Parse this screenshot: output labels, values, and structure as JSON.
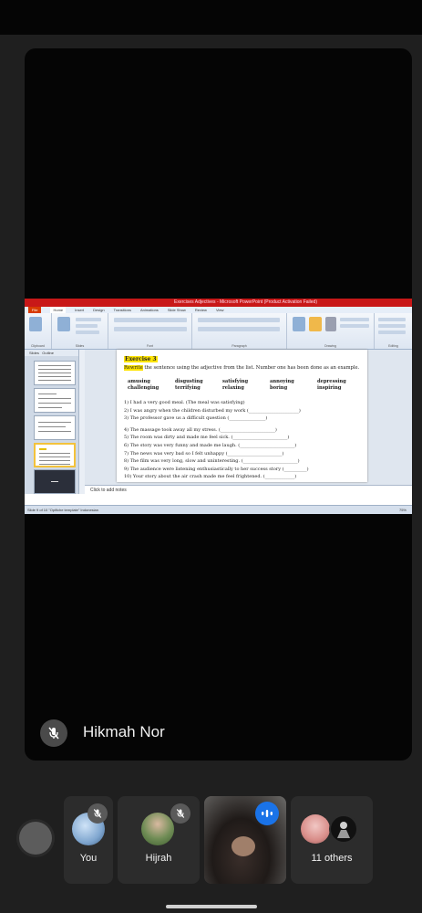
{
  "ppt": {
    "window_title": "Exercises Adjectives - Microsoft PowerPoint (Product Activation Failed)",
    "tabs": [
      "File",
      "Home",
      "Insert",
      "Design",
      "Transitions",
      "Animations",
      "Slide Show",
      "Review",
      "View"
    ],
    "ribbon_groups": [
      "Clipboard",
      "Slides",
      "Font",
      "Paragraph",
      "Drawing",
      "Editing"
    ],
    "panel_tabs": [
      "Slides",
      "Outline"
    ],
    "notes_placeholder": "Click to add notes",
    "status_left": "Slide 9 of 10   \"Opifiche template\"   Indonesian",
    "status_right": "75%"
  },
  "slide": {
    "exercise_title": "Exercise 3",
    "instruction_highlight": "Rewrite",
    "instruction_rest": " the sentence using the adjective from the list. Number one has been done as an example.",
    "adjectives": [
      "amusing",
      "disgusting",
      "satisfying",
      "annoying",
      "depressing",
      "challenging",
      "terrifying",
      "relaxing",
      "boring",
      "inspiring"
    ],
    "sentences_a": [
      "1)   I had a very good meal. (The meal was satisfying)",
      "2)   I was angry when the children disturbed my work (______________________)",
      "3)   The professor gave us a difficult question (________________)"
    ],
    "sentences_b": [
      "4)   The massage took away all my stress. (________________________)",
      "5)   The room was dirty and made me feel sick. (________________________)",
      "6)   The story was very funny and made me laugh. (________________________)",
      "7)   The news was very bad so I felt unhappy (________________________)",
      "8)   The film was very long, slow and uninteresting. (________________________)",
      "9)   The audience were listening enthusiastically to her success story (__________)",
      "10)  Your story about the air crash made me feel frightened. (_____________)"
    ]
  },
  "speaker": {
    "name": "Hikmah Nor"
  },
  "participants": [
    {
      "label": "You",
      "muted": true
    },
    {
      "label": "Hijrah",
      "muted": true
    },
    {
      "label": "",
      "speaking": true
    },
    {
      "label": "11 others"
    }
  ],
  "colors": {
    "background": "#1f1f1f",
    "stage": "#050505",
    "tile": "#2c2c2c",
    "speaking": "#1a73e8",
    "highlight": "#ffe400"
  }
}
